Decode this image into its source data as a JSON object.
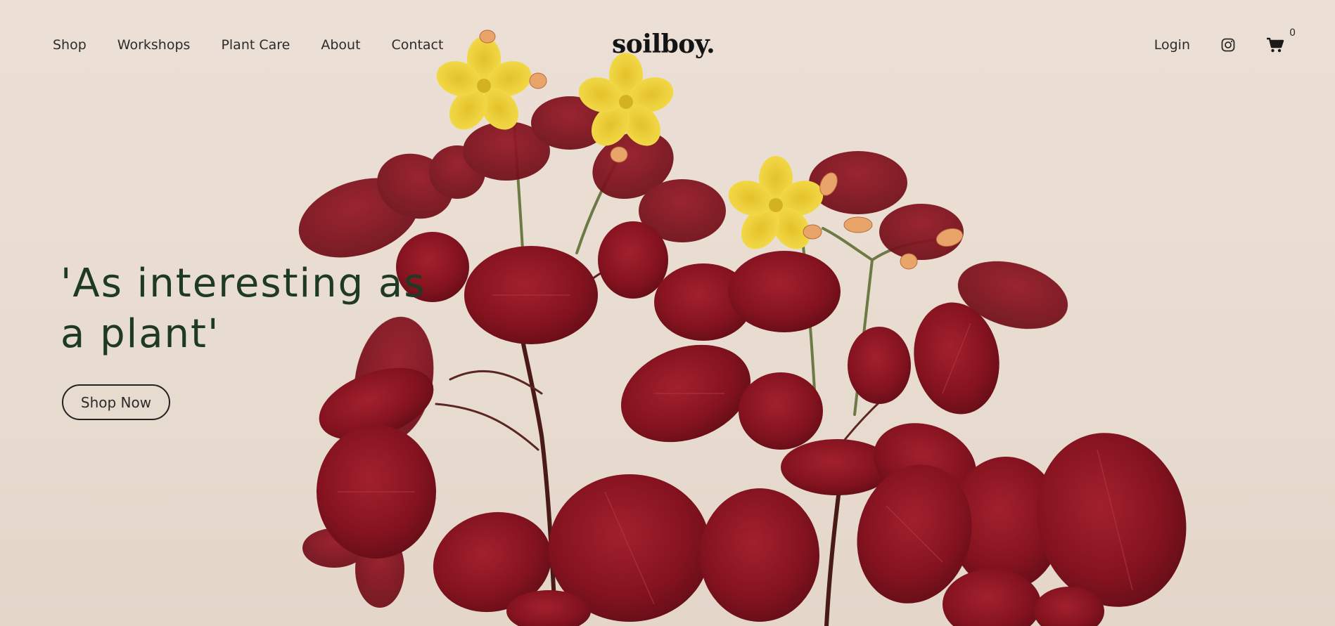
{
  "nav": {
    "items": [
      {
        "label": "Shop"
      },
      {
        "label": "Workshops"
      },
      {
        "label": "Plant Care"
      },
      {
        "label": "About"
      },
      {
        "label": "Contact"
      }
    ]
  },
  "brand": {
    "logo": "soilboy."
  },
  "header_right": {
    "login_label": "Login",
    "instagram_icon": "instagram-icon",
    "cart_icon": "cart-icon",
    "cart_count": "0"
  },
  "hero": {
    "headline": "'As interesting as a plant'",
    "cta_label": "Shop Now",
    "image": "red-leaf-plant-with-yellow-flowers"
  },
  "colors": {
    "background": "#e9ddd2",
    "headline": "#1e3a24",
    "leaf": "#8a1522",
    "flower": "#f2d23a",
    "text": "#2b2b2b"
  }
}
